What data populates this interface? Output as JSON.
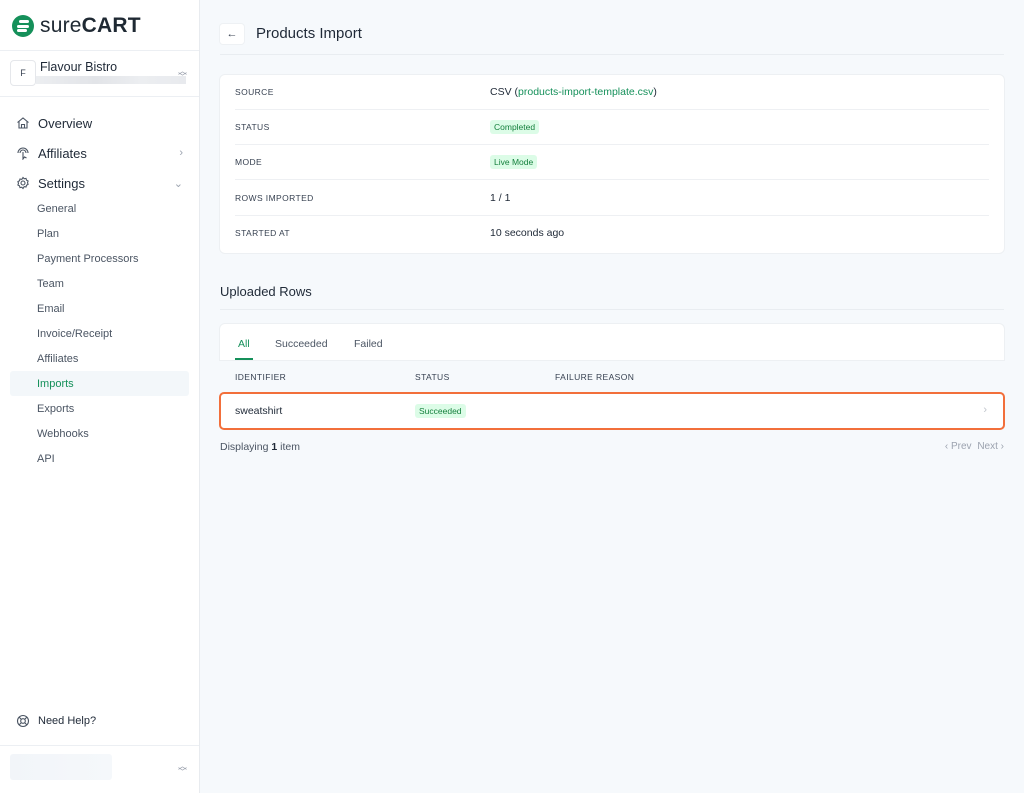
{
  "brand": {
    "name_light": "sure",
    "name_bold": "CART",
    "color": "#15905a"
  },
  "store": {
    "initial": "F",
    "name": "Flavour Bistro"
  },
  "nav": {
    "main": [
      {
        "label": "Overview",
        "icon": "home-icon"
      },
      {
        "label": "Affiliates",
        "icon": "affiliates-icon",
        "chevron": "›"
      },
      {
        "label": "Settings",
        "icon": "gear-icon",
        "chevron": "⌄"
      }
    ],
    "settings_items": [
      {
        "label": "General"
      },
      {
        "label": "Plan"
      },
      {
        "label": "Payment Processors"
      },
      {
        "label": "Team"
      },
      {
        "label": "Email"
      },
      {
        "label": "Invoice/Receipt"
      },
      {
        "label": "Affiliates"
      },
      {
        "label": "Imports",
        "active": true
      },
      {
        "label": "Exports"
      },
      {
        "label": "Webhooks"
      },
      {
        "label": "API"
      }
    ],
    "help_label": "Need Help?"
  },
  "page": {
    "back_icon": "←",
    "title": "Products Import"
  },
  "details": {
    "source": {
      "label": "SOURCE",
      "prefix": "CSV (",
      "file": "products-import-template.csv",
      "suffix": ")"
    },
    "status": {
      "label": "STATUS",
      "value": "Completed"
    },
    "mode": {
      "label": "MODE",
      "value": "Live Mode"
    },
    "rows_imported": {
      "label": "ROWS IMPORTED",
      "value": "1 / 1"
    },
    "started_at": {
      "label": "STARTED AT",
      "value": "10 seconds ago"
    }
  },
  "uploaded_rows": {
    "title": "Uploaded Rows",
    "tabs": [
      {
        "label": "All",
        "active": true
      },
      {
        "label": "Succeeded"
      },
      {
        "label": "Failed"
      }
    ],
    "columns": [
      "IDENTIFIER",
      "STATUS",
      "FAILURE REASON"
    ],
    "rows": [
      {
        "identifier": "sweatshirt",
        "status": "Succeeded",
        "failure_reason": ""
      }
    ],
    "footer": {
      "prefix": "Displaying ",
      "count": "1",
      "suffix": " item"
    },
    "pager": {
      "prev": "‹ Prev",
      "next": "Next ›"
    }
  },
  "colors": {
    "accent": "#15905a",
    "badge_bg": "#dcfce7",
    "highlight_border": "#f26f3b"
  }
}
